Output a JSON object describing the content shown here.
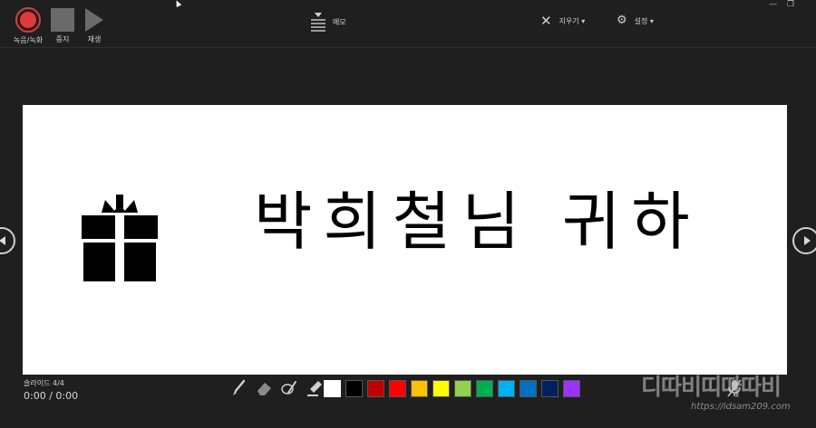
{
  "toolbar": {
    "record_label": "녹음/녹화",
    "stop_label": "중지",
    "play_label": "재생",
    "memo_label": "메모",
    "erase_label": "지우기 ▾",
    "settings_label": "설정 ▾",
    "minimize_glyph": "—",
    "restore_glyph": "❐"
  },
  "slide": {
    "title": "박희철님 귀하"
  },
  "footer": {
    "slide_counter": "슬라이드 4/4",
    "timer": "0:00 / 0:00"
  },
  "ink_colors": [
    "#ffffff",
    "#000000",
    "#c00000",
    "#ff0000",
    "#ffc000",
    "#ffff00",
    "#92d050",
    "#00b050",
    "#00b0f0",
    "#0070c0",
    "#002060",
    "#9933ff"
  ],
  "icons": {
    "record": "record-icon",
    "stop": "stop-icon",
    "play": "play-icon",
    "memo": "memo-icon",
    "erase": "erase-icon",
    "settings": "gear-icon",
    "gift": "gift-icon",
    "prev": "prev-slide-icon",
    "next": "next-slide-icon",
    "pen": "pen-icon",
    "eraser": "eraser-icon",
    "lasso": "lasso-icon",
    "highlighter": "highlighter-icon",
    "mic": "microphone-muted-icon"
  },
  "watermark": {
    "brand": "디따비띠따따비",
    "url": "https://idsam209.com"
  }
}
